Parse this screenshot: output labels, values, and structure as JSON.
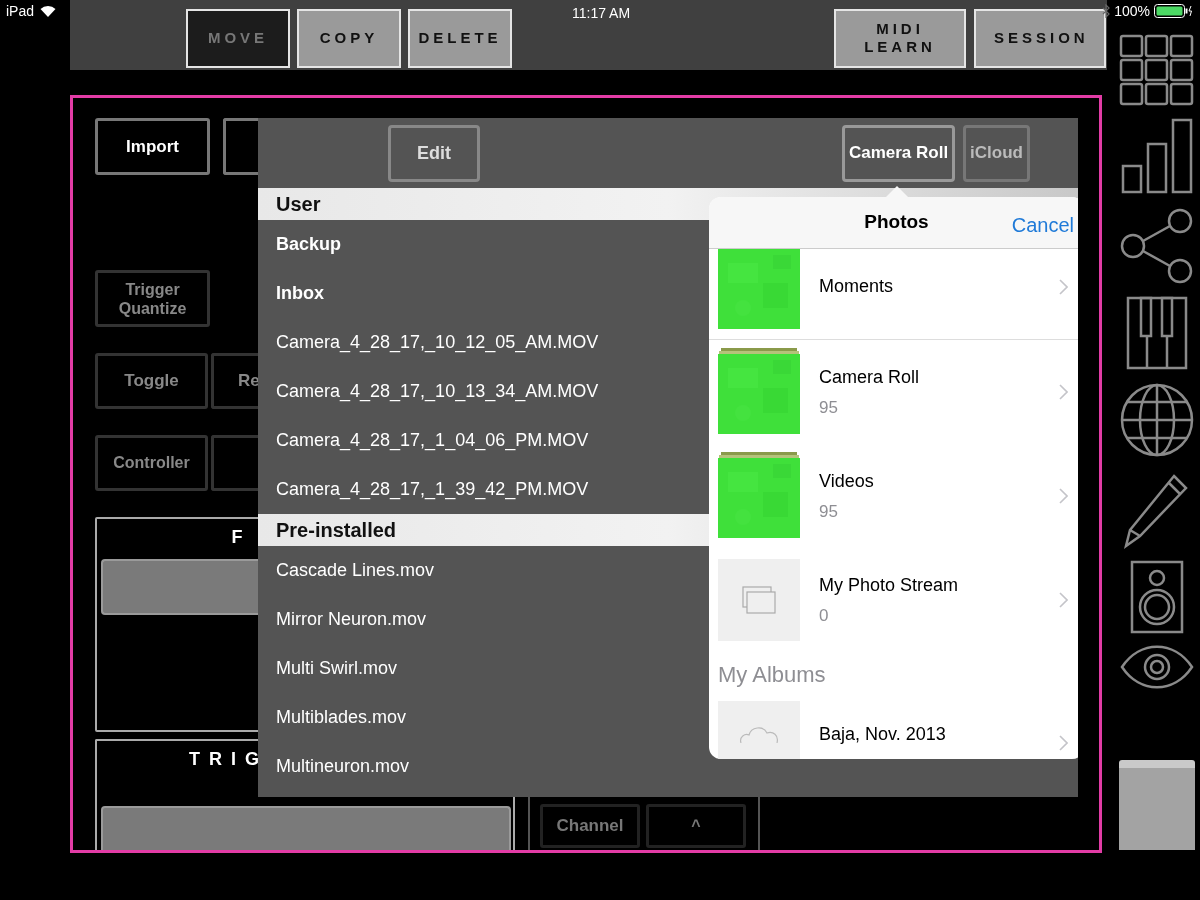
{
  "status_bar": {
    "device": "iPad",
    "time": "11:17 AM",
    "battery": "100%"
  },
  "toolbar": {
    "left_buttons": [
      {
        "label": "MOVE",
        "selected": true
      },
      {
        "label": "COPY",
        "selected": false
      },
      {
        "label": "DELETE",
        "selected": false
      }
    ],
    "right_buttons": [
      {
        "label": "MIDI LEARN"
      },
      {
        "label": "SESSION"
      }
    ]
  },
  "controls": {
    "import": "Import",
    "trigger_quantize": "Trigger Quantize",
    "toggle": "Toggle",
    "toggle_neighbor": "Re",
    "controller": "Controller",
    "panel_f": "F",
    "panel_trigger": "TRIG",
    "channel": "Channel",
    "up": "^"
  },
  "file_browser": {
    "edit": "Edit",
    "sources": [
      {
        "label": "Camera Roll",
        "selected": true
      },
      {
        "label": "iCloud",
        "selected": false
      }
    ],
    "sections": [
      {
        "title": "User",
        "items": [
          {
            "name": "Backup",
            "kind": "folder"
          },
          {
            "name": "Inbox",
            "kind": "folder"
          },
          {
            "name": "Camera_4_28_17,_10_12_05_AM.MOV",
            "kind": "file"
          },
          {
            "name": "Camera_4_28_17,_10_13_34_AM.MOV",
            "kind": "file"
          },
          {
            "name": "Camera_4_28_17,_1_04_06_PM.MOV",
            "kind": "file"
          },
          {
            "name": "Camera_4_28_17,_1_39_42_PM.MOV",
            "kind": "file"
          }
        ]
      },
      {
        "title": "Pre-installed",
        "items": [
          {
            "name": "Cascade Lines.mov",
            "kind": "file"
          },
          {
            "name": "Mirror Neuron.mov",
            "kind": "file"
          },
          {
            "name": "Multi Swirl.mov",
            "kind": "file"
          },
          {
            "name": "Multiblades.mov",
            "kind": "file"
          },
          {
            "name": "Multineuron.mov",
            "kind": "file"
          }
        ]
      }
    ]
  },
  "photos": {
    "title": "Photos",
    "cancel": "Cancel",
    "albums": [
      {
        "name": "Moments",
        "kind": "single"
      },
      {
        "name": "Camera Roll",
        "count": "95",
        "kind": "stack"
      },
      {
        "name": "Videos",
        "count": "95",
        "kind": "stack"
      },
      {
        "name": "My Photo Stream",
        "count": "0",
        "kind": "stream"
      }
    ],
    "section": "My Albums",
    "my_albums": [
      {
        "name": "Baja, Nov. 2013",
        "kind": "cloud"
      }
    ]
  }
}
